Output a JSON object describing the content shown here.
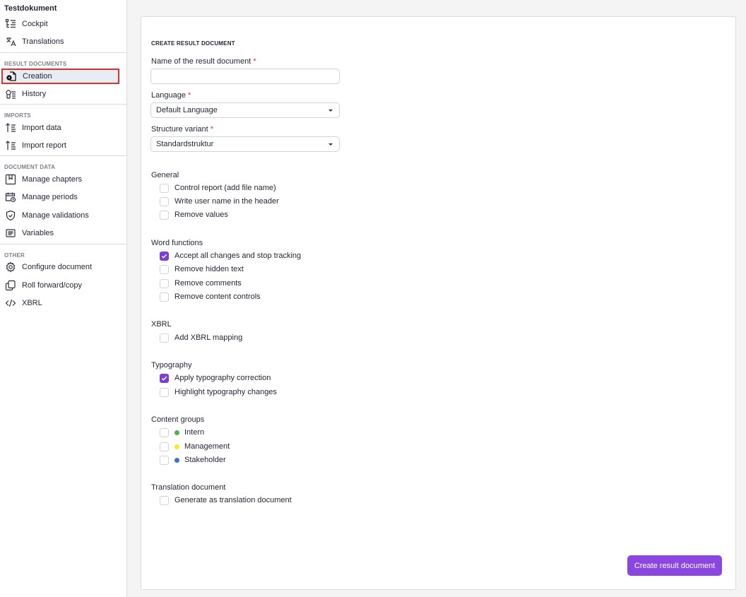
{
  "sidebar": {
    "doc_title": "Testdokument",
    "top_items": [
      {
        "label": "Cockpit",
        "icon": "cockpit-icon"
      },
      {
        "label": "Translations",
        "icon": "translate-icon"
      }
    ],
    "sections": [
      {
        "label": "RESULT DOCUMENTS",
        "items": [
          {
            "label": "Creation",
            "icon": "document-gear-icon",
            "active": true
          },
          {
            "label": "History",
            "icon": "history-icon"
          }
        ]
      },
      {
        "label": "IMPORTS",
        "items": [
          {
            "label": "Import data",
            "icon": "import-icon"
          },
          {
            "label": "Import report",
            "icon": "import-icon"
          }
        ]
      },
      {
        "label": "DOCUMENT DATA",
        "items": [
          {
            "label": "Manage chapters",
            "icon": "bookmark-book-icon"
          },
          {
            "label": "Manage periods",
            "icon": "calendar-clock-icon"
          },
          {
            "label": "Manage validations",
            "icon": "shield-check-icon"
          },
          {
            "label": "Variables",
            "icon": "list-box-icon"
          }
        ]
      },
      {
        "label": "OTHER",
        "items": [
          {
            "label": "Configure document",
            "icon": "gear-icon"
          },
          {
            "label": "Roll forward/copy",
            "icon": "copy-icon"
          },
          {
            "label": "XBRL",
            "icon": "code-icon"
          }
        ]
      }
    ]
  },
  "form": {
    "title": "CREATE RESULT DOCUMENT",
    "name_label": "Name of the result document",
    "name_value": "",
    "name_placeholder": "",
    "language_label": "Language",
    "language_value": "Default Language",
    "structure_label": "Structure variant",
    "structure_value": "Standardstruktur",
    "required_mark": "*",
    "groups": {
      "general": {
        "heading": "General",
        "options": [
          {
            "label": "Control report (add file name)",
            "checked": false
          },
          {
            "label": "Write user name in the header",
            "checked": false
          },
          {
            "label": "Remove values",
            "checked": false
          }
        ]
      },
      "word": {
        "heading": "Word functions",
        "options": [
          {
            "label": "Accept all changes and stop tracking",
            "checked": true
          },
          {
            "label": "Remove hidden text",
            "checked": false
          },
          {
            "label": "Remove comments",
            "checked": false
          },
          {
            "label": "Remove content controls",
            "checked": false
          }
        ]
      },
      "xbrl": {
        "heading": "XBRL",
        "options": [
          {
            "label": "Add XBRL mapping",
            "checked": false
          }
        ]
      },
      "typography": {
        "heading": "Typography",
        "options": [
          {
            "label": "Apply typography correction",
            "checked": true
          },
          {
            "label": "Highlight typography changes",
            "checked": false
          }
        ]
      },
      "content_groups": {
        "heading": "Content groups",
        "options": [
          {
            "label": "Intern",
            "checked": false,
            "color": "#4caf50"
          },
          {
            "label": "Management",
            "checked": false,
            "color": "#f2ea2b"
          },
          {
            "label": "Stakeholder",
            "checked": false,
            "color": "#3f6fc6"
          }
        ]
      },
      "translation": {
        "heading": "Translation document",
        "options": [
          {
            "label": "Generate as translation document",
            "checked": false
          }
        ]
      }
    },
    "submit_label": "Create result document"
  },
  "colors": {
    "accent": "#8b46e0",
    "checkbox_checked": "#7c3ed6",
    "active_highlight": "#e0302a",
    "required": "#d9372e"
  }
}
